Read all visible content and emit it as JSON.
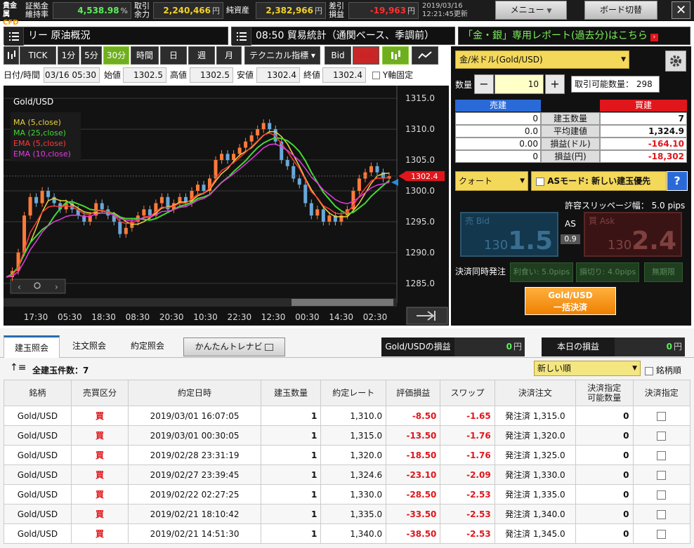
{
  "topbar": {
    "brand_top": "貴金属",
    "brand_bottom": "CFD",
    "margin_label": "証拠金\n維持率",
    "margin_value": "4,538.98",
    "margin_unit": "%",
    "avail_label": "取引\n余力",
    "avail_value": "2,240,466",
    "avail_unit": "円",
    "net_label": "純資産",
    "net_value": "2,382,966",
    "net_unit": "円",
    "pl_label": "差引\n損益",
    "pl_value": "-19,963",
    "pl_unit": "円",
    "date": "2019/03/16",
    "time_updated": "12:21:45更新",
    "menu_btn": "メニュー",
    "board_btn": "ボード切替",
    "close": "✕"
  },
  "ticker": {
    "news1": "リー 原油概況",
    "news2": "08:50 貿易統計（通関ベース、季調前）",
    "report": "「金・銀」専用レポート(過去分)はこちら"
  },
  "chart_toolbar": {
    "items": [
      "TICK",
      "1分",
      "5分",
      "30分",
      "時間",
      "日",
      "週",
      "月"
    ],
    "active": "30分",
    "tech": "テクニカル指標 ▾",
    "bid": "Bid",
    "ask": "Ask"
  },
  "ohlc": {
    "dt_label": "日付/時間",
    "dt": "03/16 05:30",
    "open_label": "始値",
    "open": "1302.5",
    "high_label": "高値",
    "high": "1302.5",
    "low_label": "安値",
    "low": "1302.4",
    "close_label": "終値",
    "close": "1302.4",
    "yfix": "Y軸固定"
  },
  "chart_data": {
    "type": "candlestick",
    "title": "Gold/USD",
    "legend": [
      {
        "name": "MA (5,close)",
        "color": "#e8d341"
      },
      {
        "name": "MA (25,close)",
        "color": "#44d832"
      },
      {
        "name": "EMA (5,close)",
        "color": "#ff3a3a"
      },
      {
        "name": "EMA (10,close)",
        "color": "#e23be0"
      }
    ],
    "y_ticks": [
      "1315.0",
      "1310.0",
      "1305.0",
      "1300.0",
      "1295.0",
      "1290.0",
      "1285.0"
    ],
    "ylim": [
      1283.5,
      1316.5
    ],
    "x_ticks": [
      "17:30",
      "05:30",
      "18:30",
      "08:30",
      "20:30",
      "10:30",
      "22:30",
      "12:30",
      "00:30",
      "14:30",
      "02:30"
    ],
    "price_tag": "1302.4",
    "close_series": [
      1286,
      1287,
      1290,
      1296,
      1299,
      1298,
      1300,
      1299,
      1298,
      1297,
      1298,
      1297,
      1296,
      1295,
      1296,
      1298,
      1297,
      1296,
      1295,
      1293,
      1294,
      1295,
      1296,
      1297,
      1296,
      1298,
      1299,
      1297,
      1298,
      1299,
      1298,
      1300,
      1301,
      1300,
      1302,
      1305,
      1306,
      1305,
      1306,
      1307,
      1308,
      1309,
      1310,
      1311,
      1310,
      1308,
      1305,
      1304,
      1302,
      1301,
      1298,
      1296,
      1297,
      1295,
      1296,
      1295,
      1296,
      1297,
      1300,
      1302,
      1303,
      1304,
      1303,
      1302,
      1302.4
    ]
  },
  "right": {
    "symbol": "金/米ドル(Gold/USD)",
    "qty_label": "数量",
    "qty": "10",
    "avail_label": "取引可能数量：",
    "avail": "298",
    "sell_head": "売建",
    "buy_head": "買建",
    "rows": [
      {
        "label": "建玉数量",
        "sell": "0",
        "buy": "7"
      },
      {
        "label": "平均建値",
        "sell": "0.0",
        "buy": "1,324.9"
      },
      {
        "label": "損益(ドル)",
        "sell": "0.00",
        "buy": "-164.10"
      },
      {
        "label": "損益(円)",
        "sell": "0",
        "buy": "-18,302"
      }
    ],
    "order_type": "クォート",
    "as_mode": "ASモード: 新しい建玉優先",
    "help": "?",
    "slip": "許容スリッページ幅：  5.0 pips",
    "bid_label": "売 Bid",
    "bid_small": "130",
    "bid_big": "1.5",
    "as_label": "AS",
    "spread": "0.9",
    "ask_label": "買 Ask",
    "ask_small": "130",
    "ask_big": "2.4",
    "settle_label": "決済同時発注",
    "tp": "利食い: 5.0pips",
    "sl": "損切り: 4.0pips",
    "expiry": "無期限",
    "close_all_1": "Gold/USD",
    "close_all_2": "一括決済"
  },
  "bottom": {
    "tabs": [
      "建玉照会",
      "注文照会",
      "約定照会"
    ],
    "easy": "かんたんトレナビ",
    "pl_sym_label": "Gold/USDの損益",
    "pl_sym": "0",
    "today_label": "本日の損益",
    "today": "0",
    "yen": "円",
    "count_label": "全建玉件数：7",
    "sort": "新しい順",
    "brand_sort": "銘柄順"
  },
  "table": {
    "headers": [
      "銘柄",
      "売買区分",
      "約定日時",
      "建玉数量",
      "約定レート",
      "評価損益",
      "スワップ",
      "決済注文",
      "決済指定\n可能数量",
      "決済指定"
    ],
    "rows": [
      [
        "Gold/USD",
        "買",
        "2019/03/01 16:07:05",
        "1",
        "1,310.0",
        "-8.50",
        "-1.65",
        "発注済 1,315.0",
        "0"
      ],
      [
        "Gold/USD",
        "買",
        "2019/03/01 00:30:05",
        "1",
        "1,315.0",
        "-13.50",
        "-1.76",
        "発注済 1,320.0",
        "0"
      ],
      [
        "Gold/USD",
        "買",
        "2019/02/28 23:31:19",
        "1",
        "1,320.0",
        "-18.50",
        "-1.76",
        "発注済 1,325.0",
        "0"
      ],
      [
        "Gold/USD",
        "買",
        "2019/02/27 23:39:45",
        "1",
        "1,324.6",
        "-23.10",
        "-2.09",
        "発注済 1,330.0",
        "0"
      ],
      [
        "Gold/USD",
        "買",
        "2019/02/22 02:27:25",
        "1",
        "1,330.0",
        "-28.50",
        "-2.53",
        "発注済 1,335.0",
        "0"
      ],
      [
        "Gold/USD",
        "買",
        "2019/02/21 18:10:42",
        "1",
        "1,335.0",
        "-33.50",
        "-2.53",
        "発注済 1,340.0",
        "0"
      ],
      [
        "Gold/USD",
        "買",
        "2019/02/21 14:51:30",
        "1",
        "1,340.0",
        "-38.50",
        "-2.53",
        "発注済 1,345.0",
        "0"
      ]
    ]
  }
}
